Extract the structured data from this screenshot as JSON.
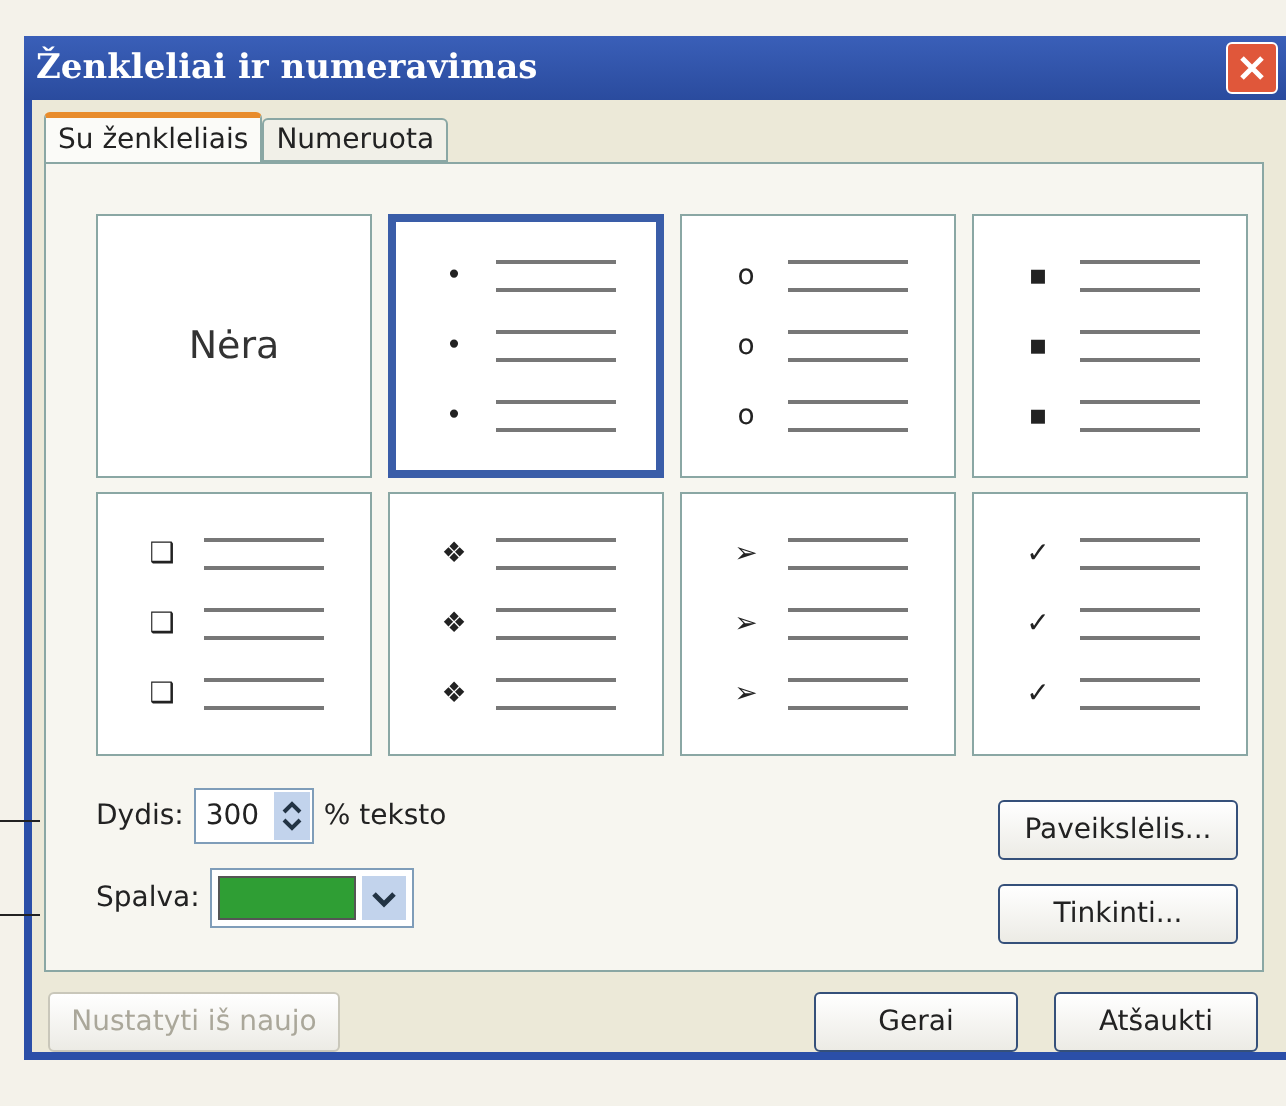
{
  "window": {
    "title": "Ženkleliai ir numeravimas"
  },
  "tabs": [
    {
      "label": "Su ženkleliais",
      "selected": true
    },
    {
      "label": "Numeruota",
      "selected": false
    }
  ],
  "bullet_styles": [
    {
      "kind": "none",
      "label": "Nėra",
      "selected": false
    },
    {
      "kind": "bullet",
      "bullets": [
        "•",
        "•",
        "•"
      ],
      "selected": true
    },
    {
      "kind": "bullet",
      "bullets": [
        "o",
        "o",
        "o"
      ],
      "selected": false
    },
    {
      "kind": "bullet",
      "bullets": [
        "▪",
        "▪",
        "▪"
      ],
      "selected": false
    },
    {
      "kind": "bullet",
      "bullets": [
        "❑",
        "❑",
        "❑"
      ],
      "selected": false
    },
    {
      "kind": "bullet",
      "bullets": [
        "❖",
        "❖",
        "❖"
      ],
      "selected": false
    },
    {
      "kind": "bullet",
      "bullets": [
        "➢",
        "➢",
        "➢"
      ],
      "selected": false
    },
    {
      "kind": "bullet",
      "bullets": [
        "✓",
        "✓",
        "✓"
      ],
      "selected": false
    }
  ],
  "size": {
    "label": "Dydis:",
    "value": "300",
    "suffix": "% teksto"
  },
  "color": {
    "label": "Spalva:",
    "color": "#2f9e34"
  },
  "side_buttons": [
    "Paveikslėlis...",
    "Tinkinti..."
  ],
  "reset_button": {
    "label": "Nustatyti iš naujo",
    "disabled": true
  },
  "buttons": [
    "Gerai",
    "Atšaukti"
  ]
}
